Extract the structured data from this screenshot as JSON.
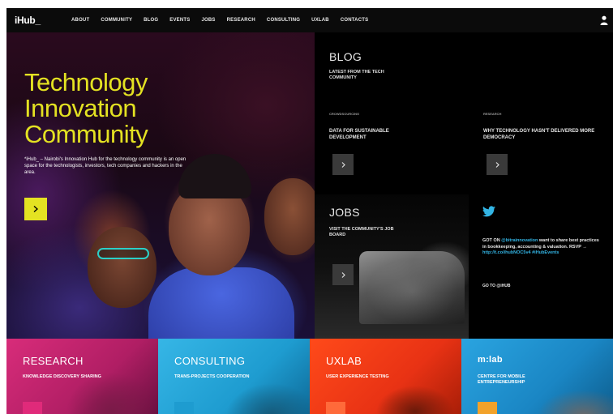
{
  "nav": {
    "logo": "iHub_",
    "items": [
      "ABOUT",
      "COMMUNITY",
      "BLOG",
      "EVENTS",
      "JOBS",
      "RESEARCH",
      "CONSULTING",
      "UXLAB",
      "CONTACTS"
    ],
    "user_icon": "user-icon"
  },
  "hero": {
    "title_lines": [
      "Technology",
      "Innovation",
      "Community"
    ],
    "description": "*iHub_ – Nairobi's Innovation Hub for the technology community is an open space for the technologists, investors, tech companies and hackers in the area.",
    "button_icon": "chevron-right-icon",
    "accent_color": "#e4e222"
  },
  "blog": {
    "title": "BLOG",
    "subtitle": "LATEST FROM THE TECH COMMUNITY",
    "posts": [
      {
        "meta": "CROWDSOURCING",
        "title": "DATA FOR SUSTAINABLE DEVELOPMENT"
      },
      {
        "meta": "RESEARCH",
        "title": "WHY TECHNOLOGY HASN'T DELIVERED MORE DEMOCRACY"
      }
    ]
  },
  "jobs": {
    "title": "JOBS",
    "subtitle": "VISIT THE COMMUNITY'S JOB BOARD"
  },
  "twitter": {
    "icon": "twitter-icon",
    "tweet_prefix": "GOT ON ",
    "tweet_handle": "@bitrainnovation",
    "tweet_body": " want to share best practices in bookkeeping, accounting & valuation. RSVP → ",
    "tweet_link": "http://t.co/ihubNOC5v4",
    "tweet_tag": " #iHubEvents",
    "follow": "GO TO @iHUB"
  },
  "tiles": [
    {
      "title": "RESEARCH",
      "subtitle": "KNOWLEDGE DISCOVERY SHARING",
      "button_color": "#e02a7a"
    },
    {
      "title": "CONSULTING",
      "subtitle": "TRANS-PROJECTS COOPERATION",
      "button_color": "#1e9cd0"
    },
    {
      "title": "UXLAB",
      "subtitle": "USER EXPERIENCE TESTING",
      "button_color": "#ff6a3a"
    },
    {
      "title": "m:lab",
      "subtitle": "CENTRE FOR MOBILE ENTREPRENEURSHIP",
      "button_color": "#f2a22a"
    }
  ],
  "colors": {
    "nav_bg": "#0b0b0b",
    "twitter_blue": "#33b5e5",
    "arrow_box": "#3a3a3a"
  }
}
